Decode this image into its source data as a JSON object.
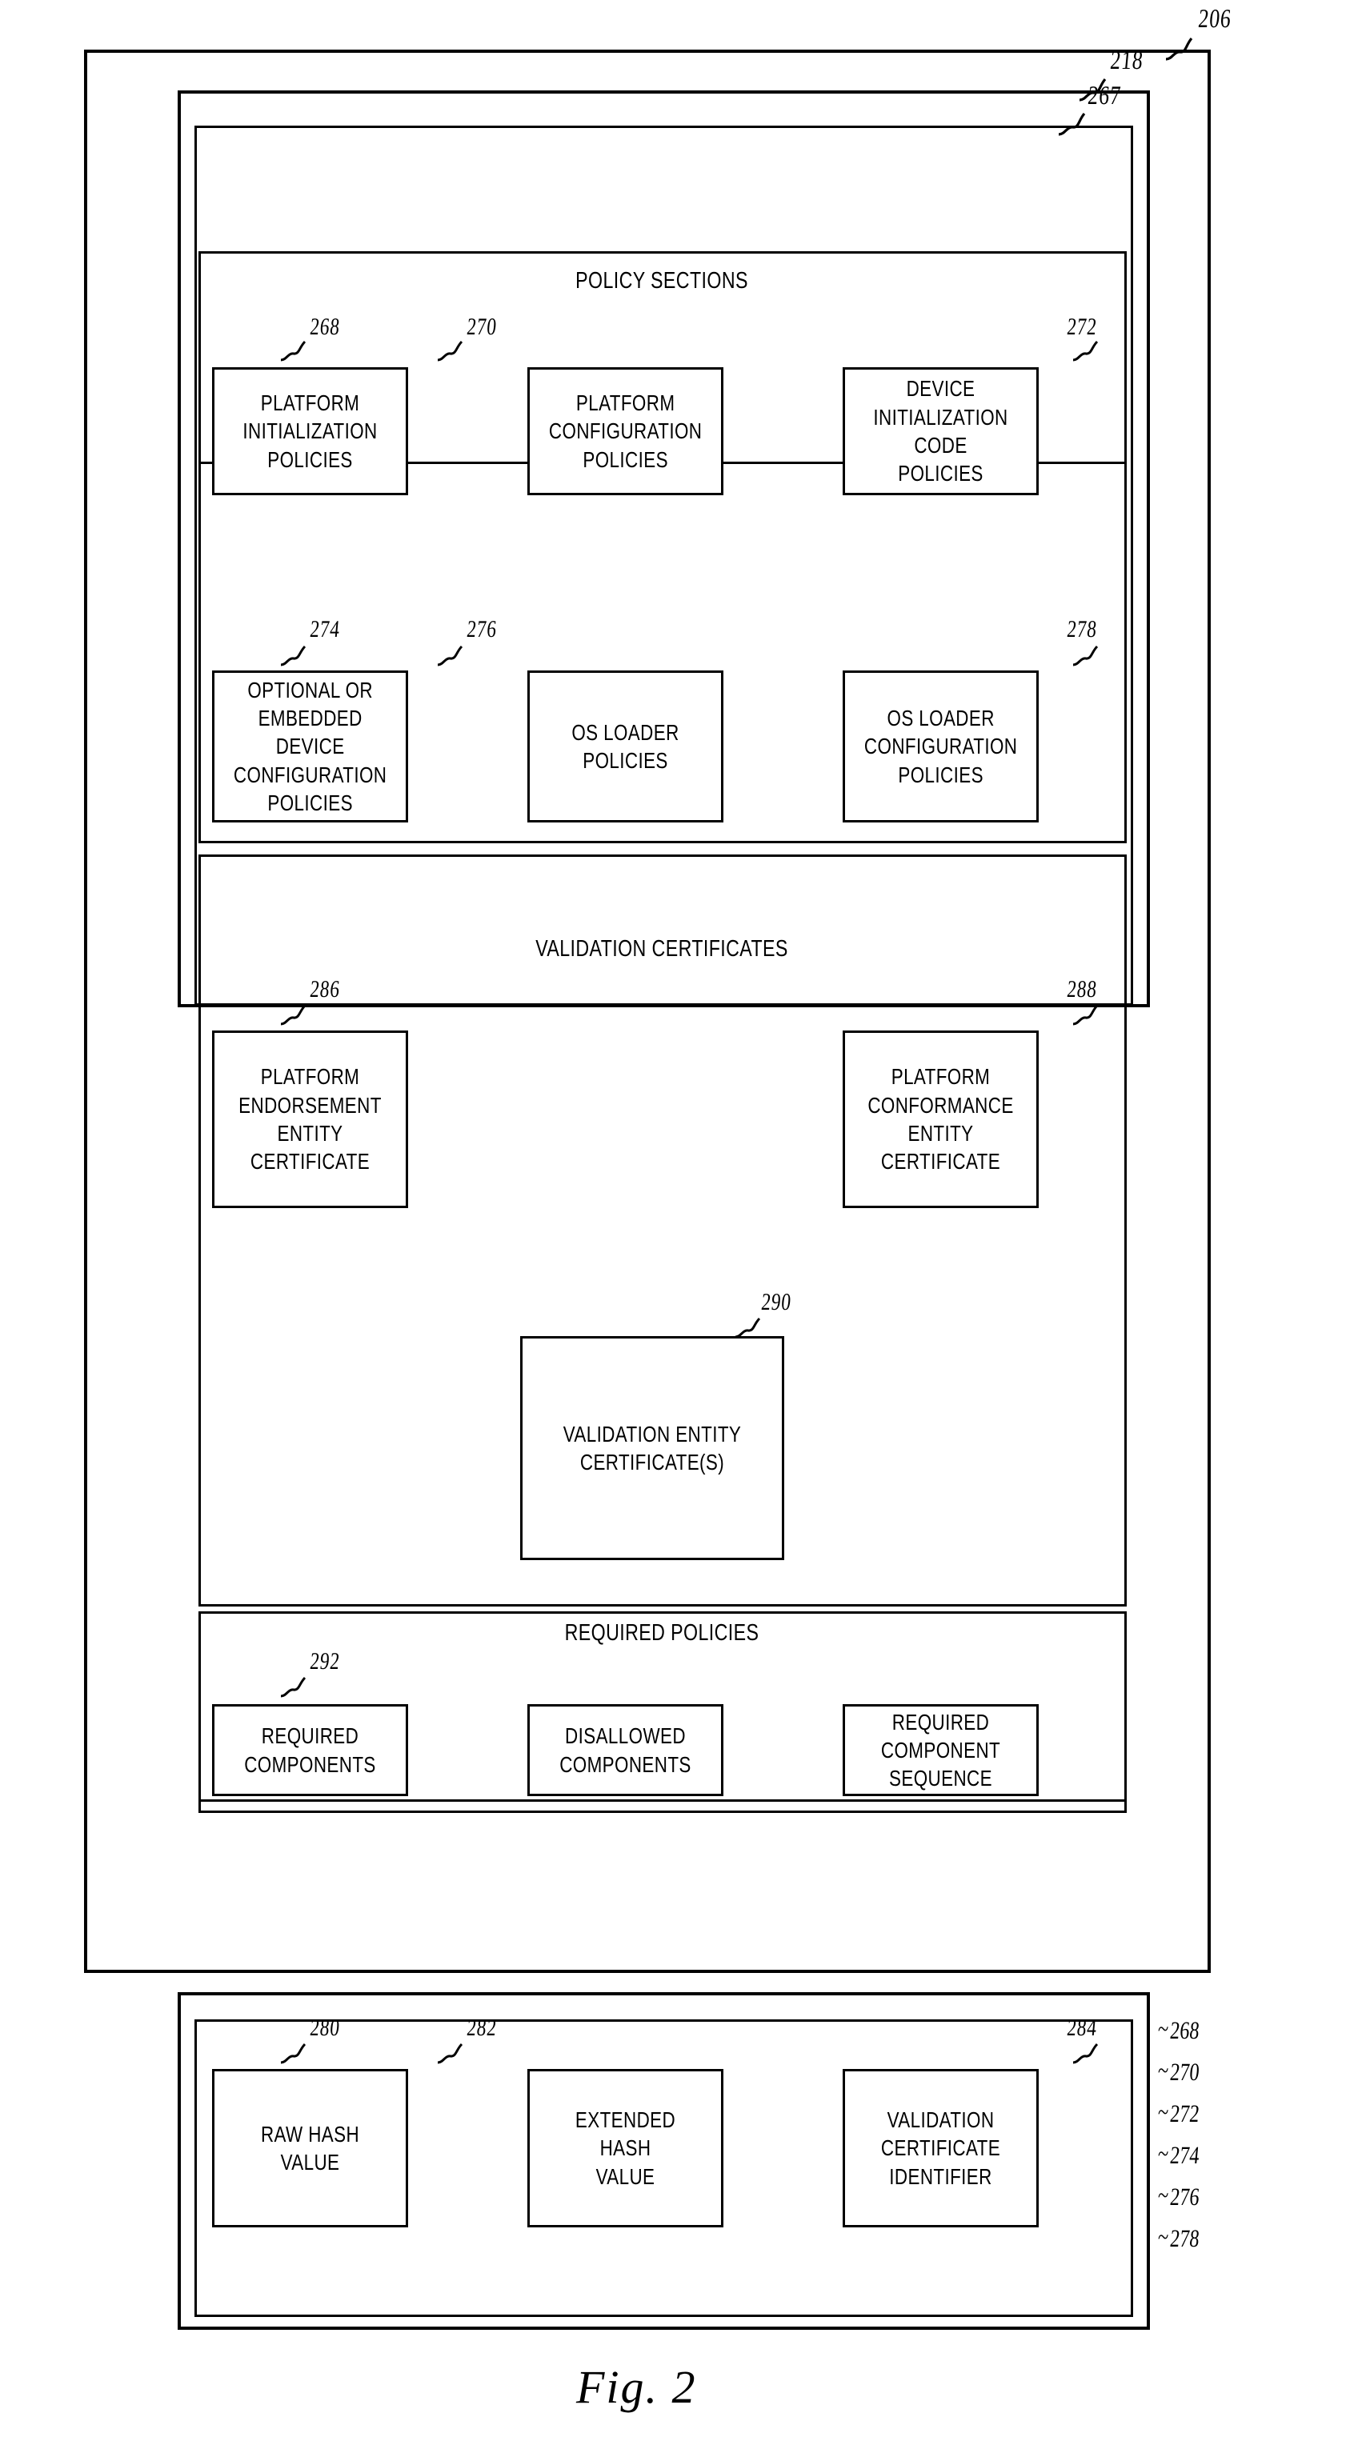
{
  "figure": {
    "caption": "Fig. 2",
    "outer_ref": "206",
    "middle_ref": "218",
    "inner_ref": "267"
  },
  "sections": {
    "policy_sections": {
      "title": "POLICY SECTIONS",
      "boxes": [
        {
          "ref": "268",
          "label": "PLATFORM\nINITIALIZATION\nPOLICIES"
        },
        {
          "ref": "270",
          "label": "PLATFORM\nCONFIGURATION\nPOLICIES"
        },
        {
          "ref": "272",
          "label": "DEVICE\nINITIALIZATION\nCODE\nPOLICIES"
        },
        {
          "ref": "274",
          "label": "OPTIONAL OR\nEMBEDDED DEVICE\nCONFIGURATION\nPOLICIES"
        },
        {
          "ref": "276",
          "label": "OS LOADER\nPOLICIES"
        },
        {
          "ref": "278",
          "label": "OS LOADER\nCONFIGURATION\nPOLICIES"
        }
      ]
    },
    "validation_certificates": {
      "title": "VALIDATION CERTIFICATES",
      "boxes": [
        {
          "ref": "286",
          "label": "PLATFORM\nENDORSEMENT\nENTITY CERTIFICATE"
        },
        {
          "ref": "288",
          "label": "PLATFORM\nCONFORMANCE\nENTITY CERTIFICATE"
        },
        {
          "ref": "290",
          "label": "VALIDATION  ENTITY\nCERTIFICATE(S)"
        }
      ]
    },
    "required_policies": {
      "title": "REQUIRED POLICIES",
      "boxes": [
        {
          "ref": "292",
          "label": "REQUIRED\nCOMPONENTS"
        },
        {
          "ref": "",
          "label": "DISALLOWED\nCOMPONENTS"
        },
        {
          "ref": "",
          "label": "REQUIRED\nCOMPONENT\nSEQUENCE"
        }
      ]
    },
    "hash_section": {
      "title": "",
      "boxes": [
        {
          "ref": "280",
          "label": "RAW HASH VALUE"
        },
        {
          "ref": "282",
          "label": "EXTENDED HASH\nVALUE"
        },
        {
          "ref": "284",
          "label": "VALIDATION\nCERTIFICATE\nIDENTIFIER"
        }
      ]
    }
  },
  "side_refs": [
    "268",
    "270",
    "272",
    "274",
    "276",
    "278"
  ]
}
